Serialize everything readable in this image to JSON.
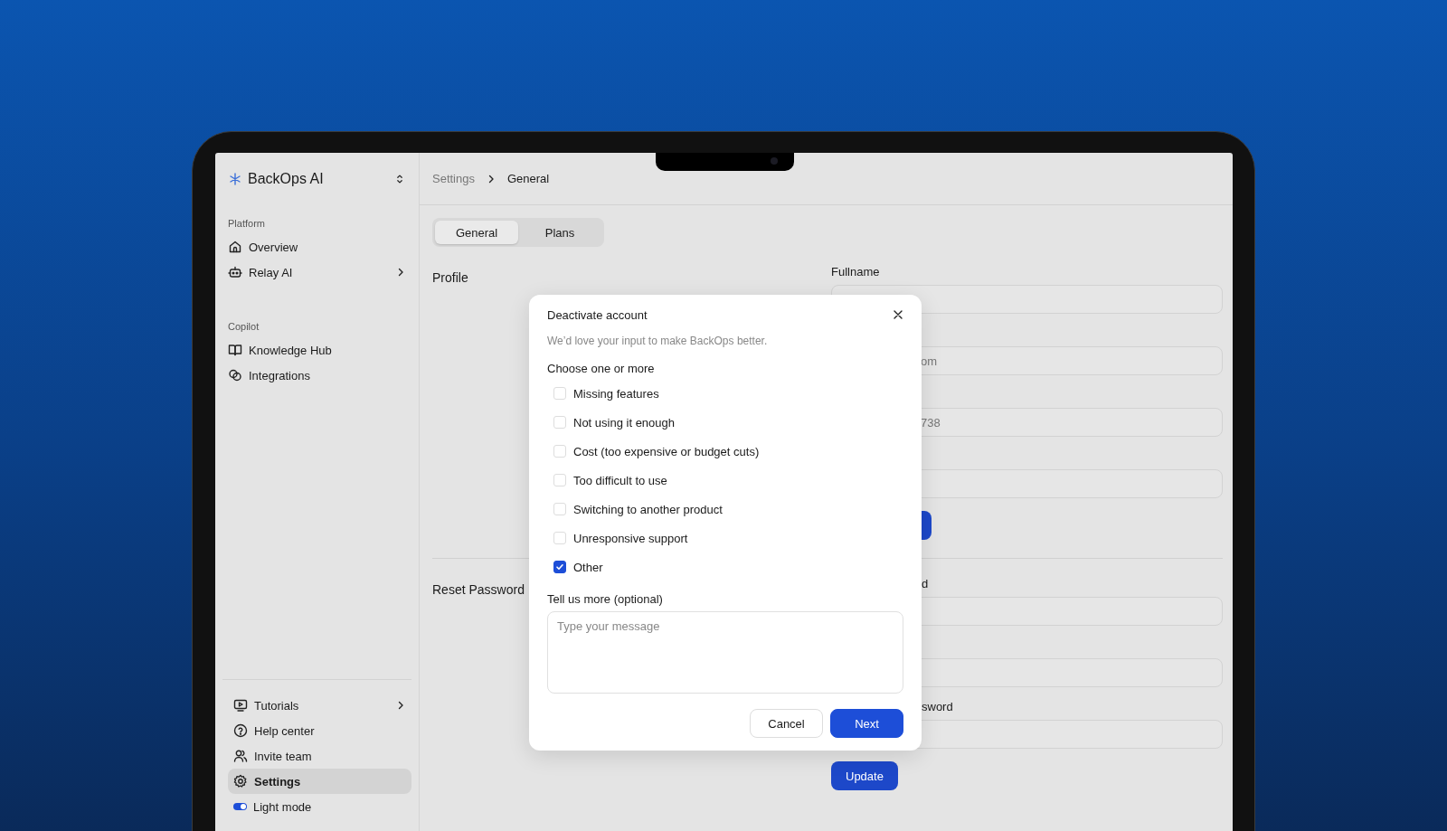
{
  "app": {
    "name": "BackOps AI"
  },
  "sidebar": {
    "sections": [
      {
        "title": "Platform",
        "items": [
          {
            "label": "Overview",
            "submenu": false,
            "selected": false
          },
          {
            "label": "Relay AI",
            "submenu": true,
            "selected": false
          }
        ]
      },
      {
        "title": "Copilot",
        "items": [
          {
            "label": "Knowledge Hub",
            "submenu": false,
            "selected": false
          },
          {
            "label": "Integrations",
            "submenu": false,
            "selected": false
          }
        ]
      }
    ],
    "footer_items": [
      {
        "kind": "link",
        "label": "Tutorials",
        "submenu": true,
        "selected": false
      },
      {
        "kind": "link",
        "label": "Help center",
        "submenu": false,
        "selected": false
      },
      {
        "kind": "link",
        "label": "Invite team",
        "submenu": false,
        "selected": false
      },
      {
        "kind": "link",
        "label": "Settings",
        "submenu": false,
        "selected": true
      },
      {
        "kind": "toggle",
        "label": "Light mode",
        "on": true
      }
    ]
  },
  "breadcrumb": [
    "Settings",
    "General"
  ],
  "tabs": [
    {
      "label": "General",
      "selected": true
    },
    {
      "label": "Plans",
      "selected": false
    }
  ],
  "profile": {
    "title": "Profile",
    "fields": [
      {
        "kind": "labeled",
        "label": "Fullname"
      },
      {
        "kind": "fragment",
        "value": "om"
      },
      {
        "kind": "fragment",
        "value": "738"
      },
      {
        "kind": "blank"
      }
    ]
  },
  "reset_password": {
    "title": "Reset Password",
    "fields": [
      {
        "kind": "fragment_label",
        "label": "d"
      },
      {
        "kind": "blank"
      },
      {
        "kind": "fragment_label",
        "label": "sword"
      }
    ],
    "button": "Update"
  },
  "modal": {
    "title": "Deactivate account",
    "subtitle": "We’d love your input to make BackOps better.",
    "prompt": "Choose one or more",
    "options": [
      {
        "label": "Missing features",
        "checked": false
      },
      {
        "label": "Not using it enough",
        "checked": false
      },
      {
        "label": "Cost (too expensive or budget cuts)",
        "checked": false
      },
      {
        "label": "Too difficult to use",
        "checked": false
      },
      {
        "label": "Switching to another product",
        "checked": false
      },
      {
        "label": "Unresponsive support",
        "checked": false
      },
      {
        "label": "Other",
        "checked": true
      }
    ],
    "message_label": "Tell us more (optional)",
    "message_placeholder": "Type your message",
    "buttons": [
      {
        "label": "Cancel",
        "kind": "secondary"
      },
      {
        "label": "Next",
        "kind": "primary"
      }
    ]
  }
}
